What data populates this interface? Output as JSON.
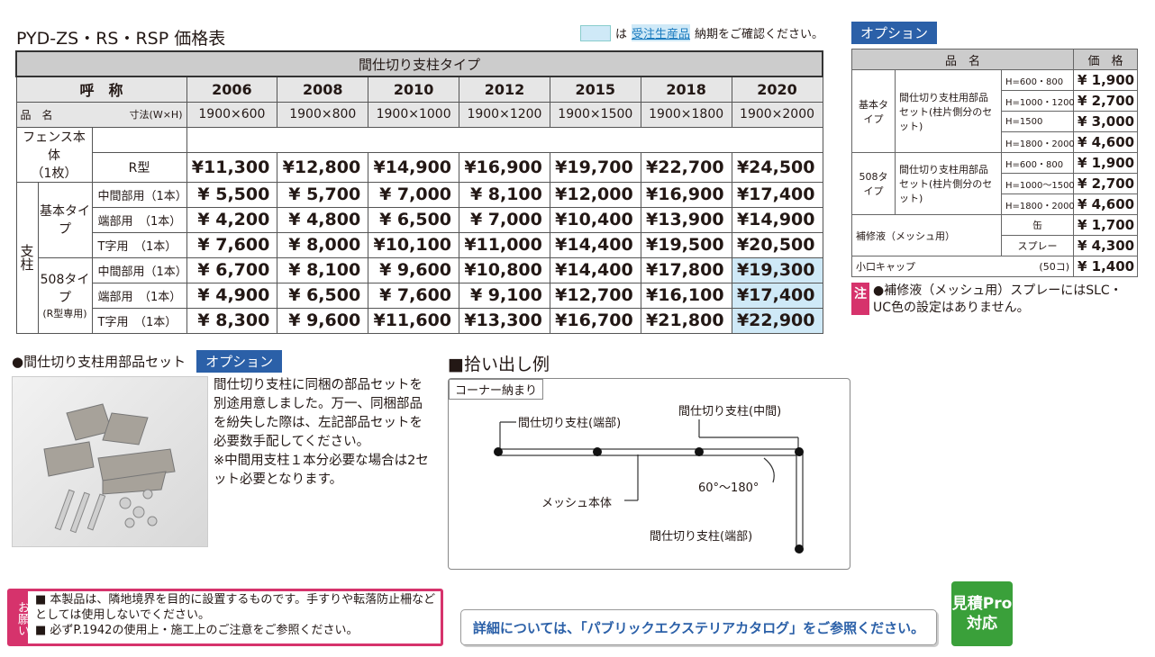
{
  "title": "PYD-ZS・RS・RSP 価格表",
  "legend": {
    "mid": "は",
    "highlight": "受注生産品",
    "suffix": "納期をご確認ください。"
  },
  "option_badge": "オプション",
  "main_table": {
    "group_header": "間仕切り支柱タイプ",
    "yobi": "呼　称",
    "sunpo": "寸法(W×H)",
    "hinmei": "品　名",
    "codes": [
      "2006",
      "2008",
      "2010",
      "2012",
      "2015",
      "2018",
      "2020"
    ],
    "sizes": [
      "1900×600",
      "1900×800",
      "1900×1000",
      "1900×1200",
      "1900×1500",
      "1900×1800",
      "1900×2000"
    ],
    "fence_label": "フェンス本体",
    "fence_count": "（1枚）",
    "r_type": "R型",
    "fence_prices": [
      "¥11,300",
      "¥12,800",
      "¥14,900",
      "¥16,900",
      "¥19,700",
      "¥22,700",
      "¥24,500"
    ],
    "shichu": "支柱",
    "kihon": "基本タイプ",
    "t508": "508タイプ",
    "t508_note": "(R型専用)",
    "rows": [
      {
        "label": "中間部用（1本）",
        "prices": [
          "¥ 5,500",
          "¥ 5,700",
          "¥ 7,000",
          "¥ 8,100",
          "¥12,000",
          "¥16,900",
          "¥17,400"
        ]
      },
      {
        "label": "端部用　（1本）",
        "prices": [
          "¥ 4,200",
          "¥ 4,800",
          "¥ 6,500",
          "¥ 7,000",
          "¥10,400",
          "¥13,900",
          "¥14,900"
        ]
      },
      {
        "label": "T字用　（1本）",
        "prices": [
          "¥ 7,600",
          "¥ 8,000",
          "¥10,100",
          "¥11,000",
          "¥14,400",
          "¥19,500",
          "¥20,500"
        ]
      },
      {
        "label": "中間部用（1本）",
        "prices": [
          "¥ 6,700",
          "¥ 8,100",
          "¥ 9,600",
          "¥10,800",
          "¥14,400",
          "¥17,800",
          "¥19,300"
        ]
      },
      {
        "label": "端部用　（1本）",
        "prices": [
          "¥ 4,900",
          "¥ 6,500",
          "¥ 7,600",
          "¥ 9,100",
          "¥12,700",
          "¥16,100",
          "¥17,400"
        ]
      },
      {
        "label": "T字用　（1本）",
        "prices": [
          "¥ 8,300",
          "¥ 9,600",
          "¥11,600",
          "¥13,300",
          "¥16,700",
          "¥21,800",
          "¥22,900"
        ]
      }
    ]
  },
  "option_table": {
    "h_name": "品　名",
    "h_price": "価　格",
    "kihon": "基本タイプ",
    "t508": "508タイプ",
    "set_name": "間仕切り支柱用部品セット(柱片側分のセット)",
    "kihon_rows": [
      {
        "h": "H=600・800",
        "p": "¥ 1,900"
      },
      {
        "h": "H=1000・1200",
        "p": "¥ 2,700"
      },
      {
        "h": "H=1500",
        "p": "¥ 3,000"
      },
      {
        "h": "H=1800・2000",
        "p": "¥ 4,600"
      }
    ],
    "t508_rows": [
      {
        "h": "H=600・800",
        "p": "¥ 1,900"
      },
      {
        "h": "H=1000～1500",
        "p": "¥ 2,700"
      },
      {
        "h": "H=1800・2000",
        "p": "¥ 4,600"
      }
    ],
    "touch": "補修液（メッシュ用）",
    "can": "缶",
    "can_p": "¥ 1,700",
    "spray": "スプレー",
    "spray_p": "¥ 4,300",
    "cap": "小口キャップ",
    "cap_unit": "(50コ)",
    "cap_p": "¥ 1,400"
  },
  "note": {
    "mark": "注",
    "text": "●補修液（メッシュ用）スプレーにはSLC・UC色の設定はありません。"
  },
  "parts": {
    "title": "●間仕切り支柱用部品セット",
    "badge": "オプション",
    "desc": "間仕切り支柱に同梱の部品セットを別途用意しました。万一、同梱部品を紛失した際は、左記部品セットを必要数手配してください。",
    "note": "※中間用支柱１本分必要な場合は2セット必要となります。"
  },
  "pickup": {
    "title": "■拾い出し例",
    "corner": "コーナー納まり",
    "end1": "間仕切り支柱(端部)",
    "mid": "間仕切り支柱(中間)",
    "angle": "60°～180°",
    "mesh": "メッシュ本体",
    "end2": "間仕切り支柱(端部)"
  },
  "onegai": {
    "mark": "お願い",
    "line1": "■ 本製品は、隣地境界を目的に設置するものです。手すりや転落防止柵などとしては使用しないでください。",
    "line2": "■ 必ずP.1942の使用上・施工上のご注意をご参照ください。"
  },
  "detail": "詳細については、「パブリックエクステリアカタログ」をご参照ください。",
  "pro": {
    "l1": "見積Pro",
    "l2": "対応"
  }
}
